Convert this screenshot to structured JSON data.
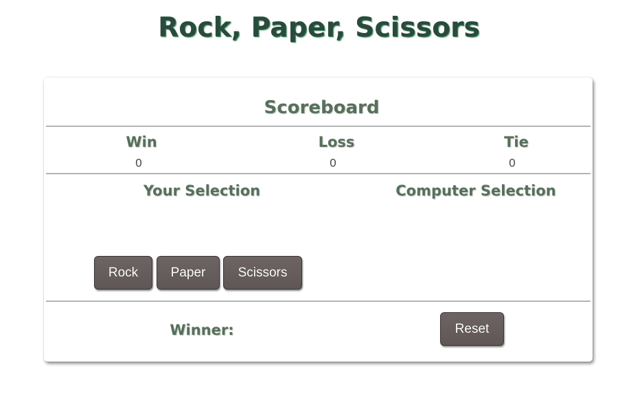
{
  "page": {
    "title": "Rock, Paper, Scissors"
  },
  "scoreboard": {
    "title": "Scoreboard",
    "win_label": "Win",
    "loss_label": "Loss",
    "tie_label": "Tie",
    "win_value": "0",
    "loss_value": "0",
    "tie_value": "0"
  },
  "selection": {
    "your_label": "Your Selection",
    "computer_label": "Computer Selection"
  },
  "choices": {
    "rock": "Rock",
    "paper": "Paper",
    "scissors": "Scissors"
  },
  "result": {
    "winner_label": "Winner:",
    "reset_label": "Reset"
  },
  "colors": {
    "title": "#2a4a3e",
    "heading": "#56705a",
    "button": "#655b5b",
    "divider": "#b3b3b3"
  }
}
